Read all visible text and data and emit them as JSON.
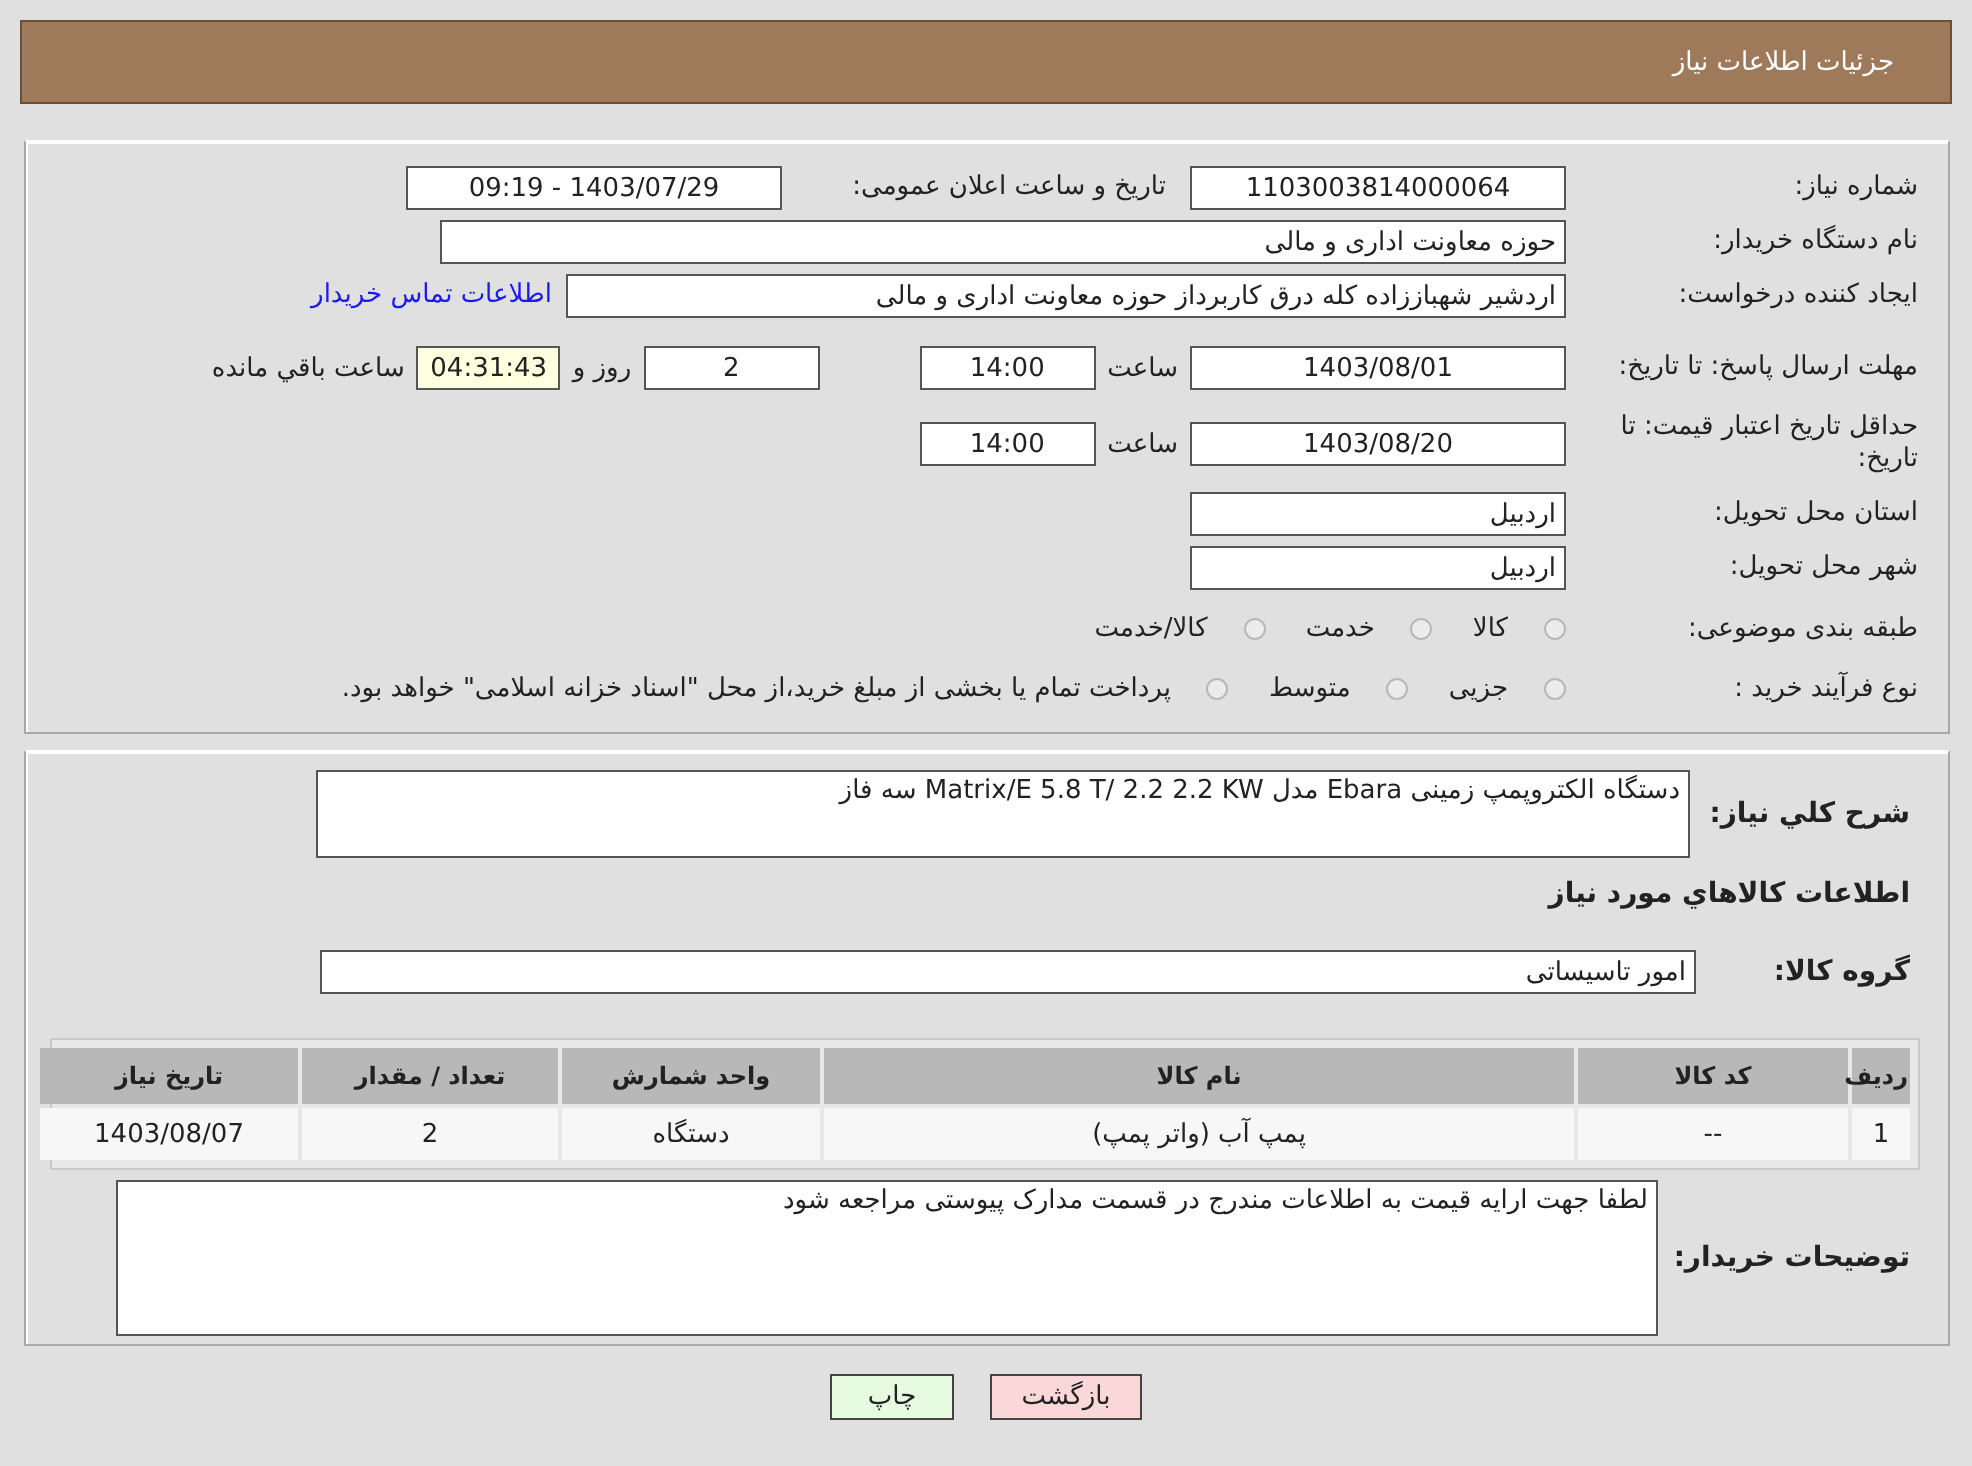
{
  "header": {
    "title": "جزئیات اطلاعات نیاز"
  },
  "need_number": {
    "label": "شماره نیاز:",
    "value": "1103003814000064"
  },
  "announce": {
    "label": "تاریخ و ساعت اعلان عمومی:",
    "value": "1403/07/29 - 09:19"
  },
  "buyer_org": {
    "label": "نام دستگاه خریدار:",
    "value": "حوزه معاونت اداری و مالی"
  },
  "requester": {
    "label": "ایجاد کننده درخواست:",
    "value": "اردشیر شهباززاده کله درق کاربرداز حوزه معاونت اداری و مالی",
    "link": "اطلاعات تماس خریدار"
  },
  "reply_deadline": {
    "label": "مهلت ارسال پاسخ: تا تاریخ:",
    "date": "1403/08/01",
    "time_label": "ساعت",
    "time": "14:00",
    "days": "2",
    "days_label": "روز و",
    "remaining": "04:31:43",
    "remaining_label": "ساعت باقي مانده"
  },
  "validity": {
    "label": "حداقل تاریخ اعتبار قیمت: تا تاریخ:",
    "date": "1403/08/20",
    "time_label": "ساعت",
    "time": "14:00"
  },
  "province": {
    "label": "استان محل تحویل:",
    "value": "اردبیل"
  },
  "city": {
    "label": "شهر محل تحویل:",
    "value": "اردبیل"
  },
  "category": {
    "label": "طبقه بندی موضوعی:",
    "options": [
      {
        "label": "کالا",
        "selected": false
      },
      {
        "label": "خدمت",
        "selected": false
      },
      {
        "label": "کالا/خدمت",
        "selected": false
      }
    ]
  },
  "process": {
    "label": "نوع فرآیند خرید :",
    "options": [
      {
        "label": "جزیی",
        "selected": false
      },
      {
        "label": "متوسط",
        "selected": false
      },
      {
        "label": "پرداخت تمام یا بخشی از مبلغ خرید،از محل \"اسناد خزانه اسلامی\" خواهد بود.",
        "selected": false
      }
    ]
  },
  "description": {
    "label": "شرح کلي نياز:",
    "value": "دستگاه الکتروپمپ زمینی Ebara  مدل Matrix/E 5.8 T/ 2.2 2.2 KW  سه فاز"
  },
  "goods_title": "اطلاعات کالاهاي مورد نياز",
  "goods_group": {
    "label": "گروه کالا:",
    "value": "امور تاسیساتی"
  },
  "table": {
    "columns": [
      "رديف",
      "کد کالا",
      "نام کالا",
      "واحد شمارش",
      "تعداد / مقدار",
      "تاریخ نیاز"
    ],
    "rows": [
      [
        "1",
        "--",
        "پمپ آب (واتر پمپ)",
        "دستگاه",
        "2",
        "1403/08/07"
      ]
    ]
  },
  "buyer_notes": {
    "label": "توضیحات خریدار:",
    "value": "لطفا جهت ارایه قیمت به اطلاعات مندرج در قسمت مدارک پیوستی مراجعه شود"
  },
  "buttons": [
    {
      "label": "بازگشت",
      "kind": "back"
    },
    {
      "label": "چاپ",
      "kind": "print"
    }
  ]
}
